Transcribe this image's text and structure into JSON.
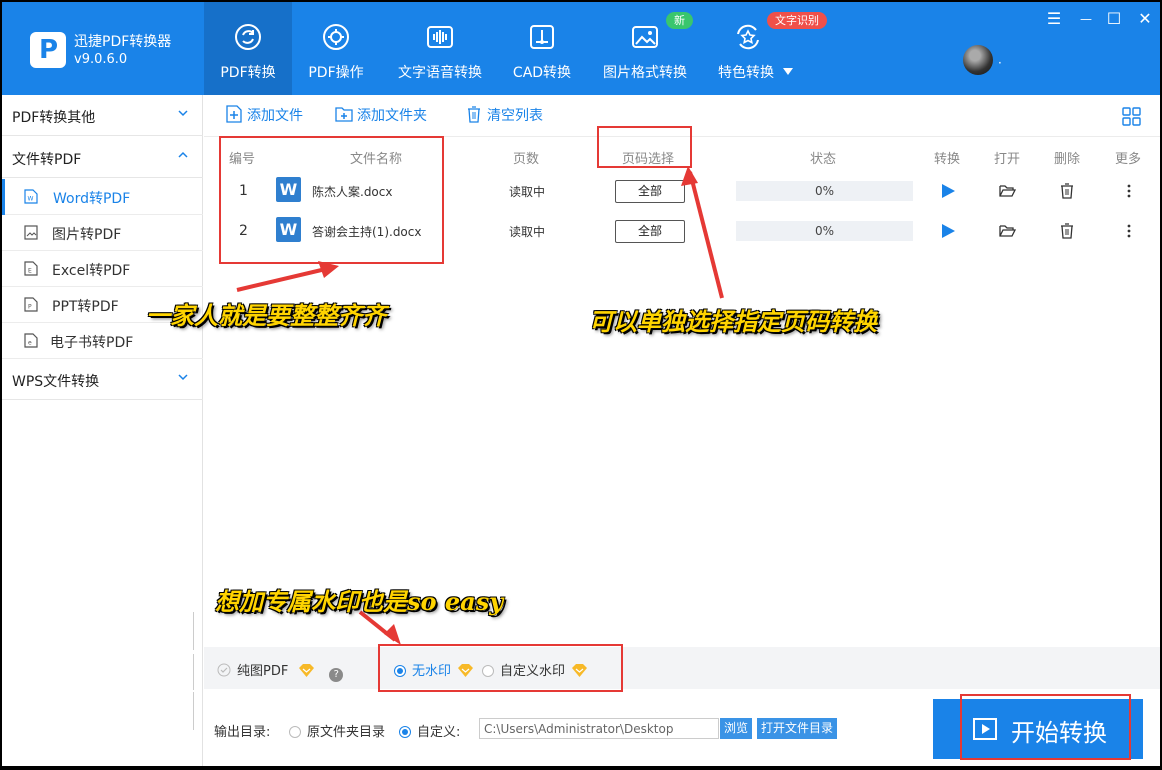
{
  "app": {
    "name": "迅捷PDF转换器",
    "version": "v9.0.6.0"
  },
  "nav": {
    "tabs": [
      {
        "label": "PDF转换",
        "icon": "refresh-circle-icon"
      },
      {
        "label": "PDF操作",
        "icon": "gear-circle-icon"
      },
      {
        "label": "文字语音转换",
        "icon": "audio-wave-icon"
      },
      {
        "label": "CAD转换",
        "icon": "cad-icon"
      },
      {
        "label": "图片格式转换",
        "icon": "image-icon"
      },
      {
        "label": "特色转换",
        "icon": "star-refresh-icon"
      }
    ],
    "badge_new": "新",
    "badge_ocr": "文字识别",
    "avatar_dot": "·"
  },
  "window": {
    "menu": "☰",
    "minimize": "—",
    "maximize": "☐",
    "close": "✕"
  },
  "sidebar": {
    "groups": [
      {
        "label": "PDF转换其他"
      },
      {
        "label": "文件转PDF"
      },
      {
        "label": "WPS文件转换"
      }
    ],
    "items": [
      {
        "label": "Word转PDF",
        "icon": "word-file-icon"
      },
      {
        "label": "图片转PDF",
        "icon": "image-file-icon"
      },
      {
        "label": "Excel转PDF",
        "icon": "excel-file-icon"
      },
      {
        "label": "PPT转PDF",
        "icon": "ppt-file-icon"
      },
      {
        "label": "电子书转PDF",
        "icon": "ebook-file-icon"
      }
    ]
  },
  "toolbar": {
    "add_file": "添加文件",
    "add_folder": "添加文件夹",
    "clear_list": "清空列表"
  },
  "table": {
    "headers": {
      "index": "编号",
      "name": "文件名称",
      "pages": "页数",
      "page_select": "页码选择",
      "status": "状态",
      "convert": "转换",
      "open": "打开",
      "delete": "删除",
      "more": "更多"
    },
    "rows": [
      {
        "index": "1",
        "name": "陈杰人案.docx",
        "pages": "读取中",
        "page_select": "全部",
        "progress": "0%",
        "progress_value": 0
      },
      {
        "index": "2",
        "name": "答谢会主持(1).docx",
        "pages": "读取中",
        "page_select": "全部",
        "progress": "0%",
        "progress_value": 0
      }
    ]
  },
  "annotations": {
    "family": "一家人就是要整整齐齐",
    "page_select": "可以单独选择指定页码转换",
    "watermark": "想加专属水印也是so easy"
  },
  "options": {
    "image_pdf": "纯图PDF",
    "help": "?",
    "no_watermark": "无水印",
    "custom_watermark": "自定义水印"
  },
  "output": {
    "label": "输出目录:",
    "source_folder": "原文件夹目录",
    "custom": "自定义:",
    "path": "C:\\Users\\Administrator\\Desktop",
    "browse": "浏览",
    "open_folder": "打开文件目录"
  },
  "start_button": "开始转换",
  "colors": {
    "primary": "#1a83e8",
    "active_tab": "#1670c9",
    "annotation": "#ffd400",
    "highlight_box": "#e53935",
    "vip_diamond": "#f7b928"
  }
}
